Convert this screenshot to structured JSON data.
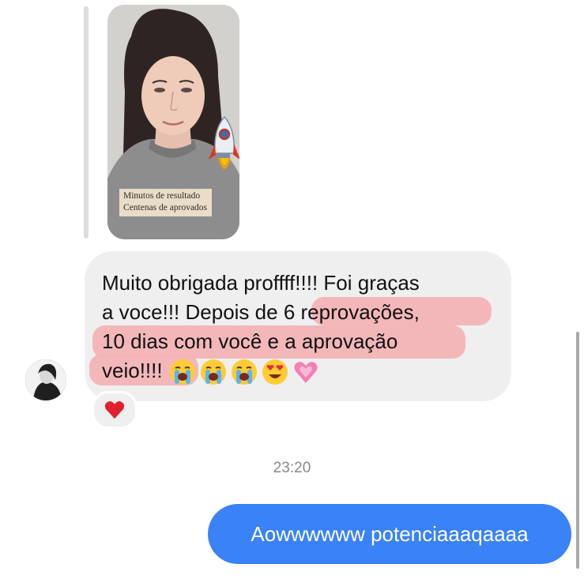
{
  "story_reply": {
    "caption_line1": "Minutos de resultado",
    "caption_line2": "Centenas de aprovados",
    "sticker": "rocket-icon"
  },
  "received_message": {
    "line1": "Muito obrigada proffff!!!! Foi graças",
    "line2_plain": "a voce!!! Depois de ",
    "line2_highlight": "6 reprovações,",
    "line3_highlight": "10 dias com você e a aprovação",
    "line4_highlight": "veio!!!!",
    "emojis": [
      "loudly-crying-face-icon",
      "loudly-crying-face-icon",
      "loudly-crying-face-icon",
      "heart-eyes-face-icon",
      "growing-heart-icon"
    ],
    "highlight_color": "#f2b3b6"
  },
  "reaction": "red-heart-icon",
  "timestamp": "23:20",
  "sent_message": {
    "text": "Aowwwwww potenciaaaqaaaa",
    "color": "#3a82f7"
  }
}
